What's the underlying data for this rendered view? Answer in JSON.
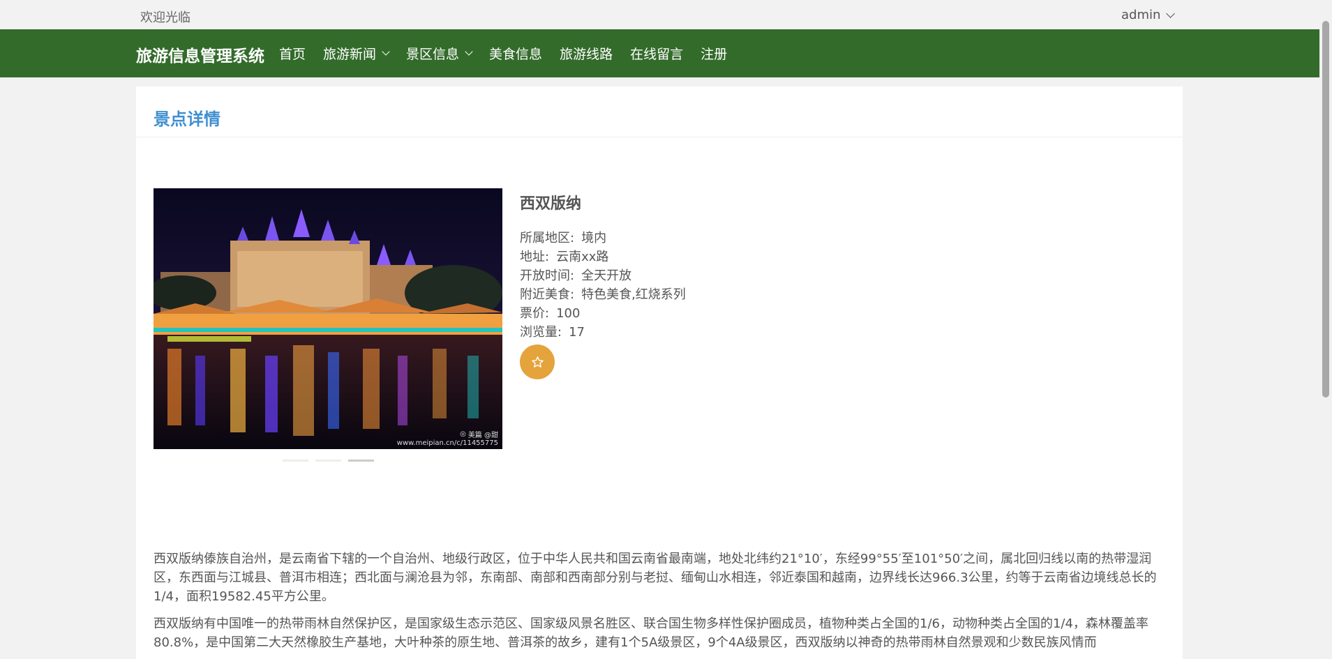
{
  "topbar": {
    "welcome": "欢迎光临",
    "user": "admin"
  },
  "navbar": {
    "brand": "旅游信息管理系统",
    "menu": [
      {
        "label": "首页",
        "dropdown": false
      },
      {
        "label": "旅游新闻",
        "dropdown": true
      },
      {
        "label": "景区信息",
        "dropdown": true
      },
      {
        "label": "美食信息",
        "dropdown": false
      },
      {
        "label": "旅游线路",
        "dropdown": false
      },
      {
        "label": "在线留言",
        "dropdown": false
      },
      {
        "label": "注册",
        "dropdown": false
      }
    ]
  },
  "card": {
    "title": "景点详情"
  },
  "carousel": {
    "watermark_brand": "美篇 @甜",
    "watermark_url": "www.meipian.cn/c/11455775",
    "slides": 3,
    "active": 2
  },
  "spot": {
    "name": "西双版纳",
    "region_label": "所属地区:",
    "region": "境内",
    "address_label": "地址:",
    "address": "云南xx路",
    "hours_label": "开放时间:",
    "hours": "全天开放",
    "food_label": "附近美食:",
    "food": "特色美食,红烧系列",
    "price_label": "票价:",
    "price": "100",
    "views_label": "浏览量:",
    "views": "17"
  },
  "description": [
    "西双版纳傣族自治州，是云南省下辖的一个自治州、地级行政区，位于中华人民共和国云南省最南端，地处北纬约21°10′，东经99°55′至101°50′之间，属北回归线以南的热带湿润区，东西面与江城县、普洱市相连；西北面与澜沧县为邻，东南部、南部和西南部分别与老挝、缅甸山水相连，邻近泰国和越南，边界线长达966.3公里，约等于云南省边境线总长的1/4，面积19582.45平方公里。",
    "西双版纳有中国唯一的热带雨林自然保护区，是国家级生态示范区、国家级风景名胜区、联合国生物多样性保护圈成员，植物种类占全国的1/6，动物种类占全国的1/4，森林覆盖率80.8%，是中国第二大天然橡胶生产基地，大叶种茶的原生地、普洱茶的故乡，建有1个5A级景区，9个4A级景区，西双版纳以神奇的热带雨林自然景观和少数民族风情而"
  ],
  "colors": {
    "nav_bg": "#336b2b",
    "title_blue": "#3f8fd0",
    "fav_orange": "#e5a33b"
  }
}
